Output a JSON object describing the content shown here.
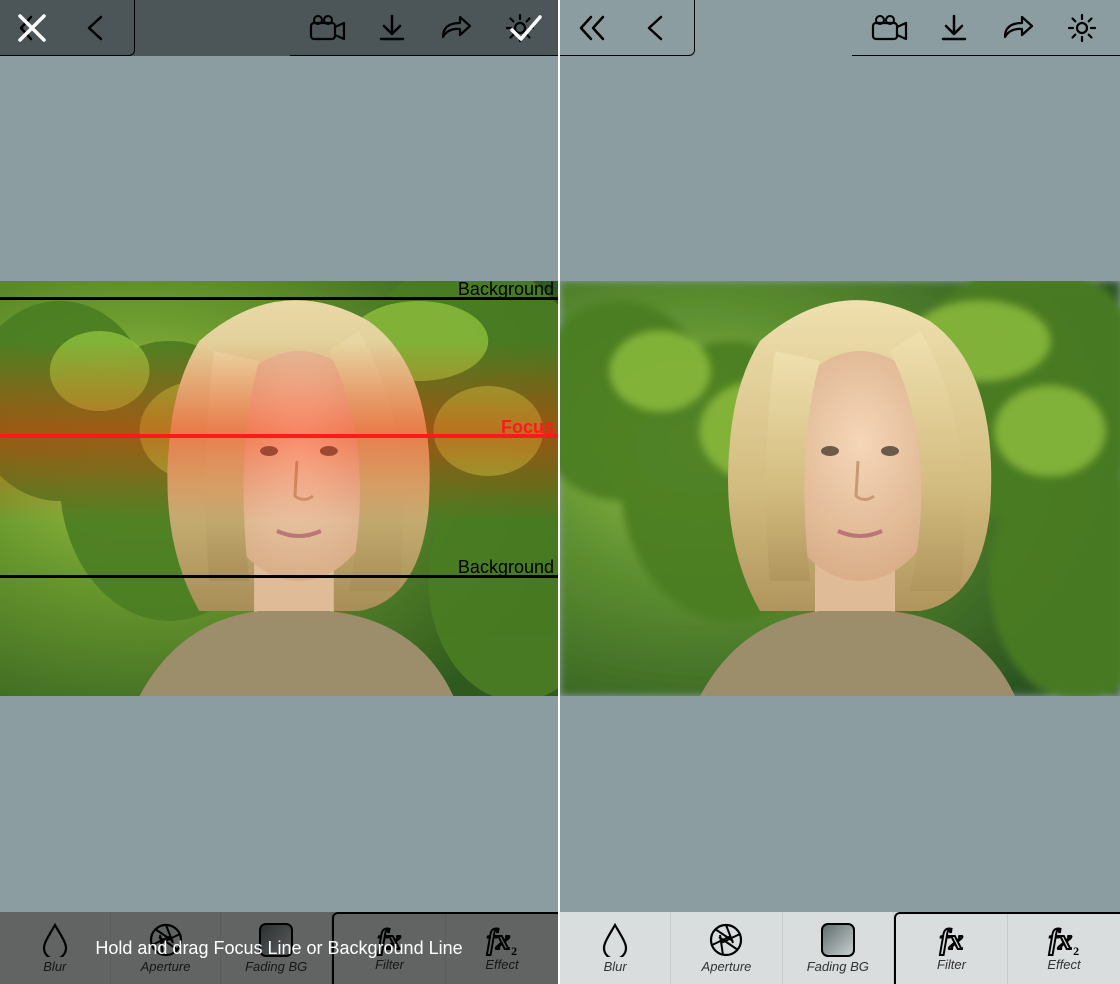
{
  "left": {
    "overlay": {
      "focus_label": "Focus",
      "background_label": "Background",
      "hint": "Hold and drag Focus Line or Background Line"
    },
    "topbar": {
      "close_icon": "close",
      "confirm_icon": "check"
    }
  },
  "right": {
    "topbar": {
      "nav_first_icon": "chevron-double-left",
      "nav_back_icon": "chevron-left",
      "video_icon": "video-camera",
      "download_icon": "download",
      "share_icon": "share",
      "settings_icon": "gear"
    }
  },
  "bottombar": {
    "items": [
      {
        "icon": "drop",
        "label": "Blur"
      },
      {
        "icon": "aperture",
        "label": "Aperture"
      },
      {
        "icon": "fading",
        "label": "Fading BG"
      },
      {
        "icon": "fx",
        "label": "Filter"
      },
      {
        "icon": "fx2",
        "label": "Effect"
      }
    ]
  },
  "colors": {
    "bg": "#8b9da0",
    "focus_line": "#ff1a1a",
    "bg_line": "#000000"
  }
}
